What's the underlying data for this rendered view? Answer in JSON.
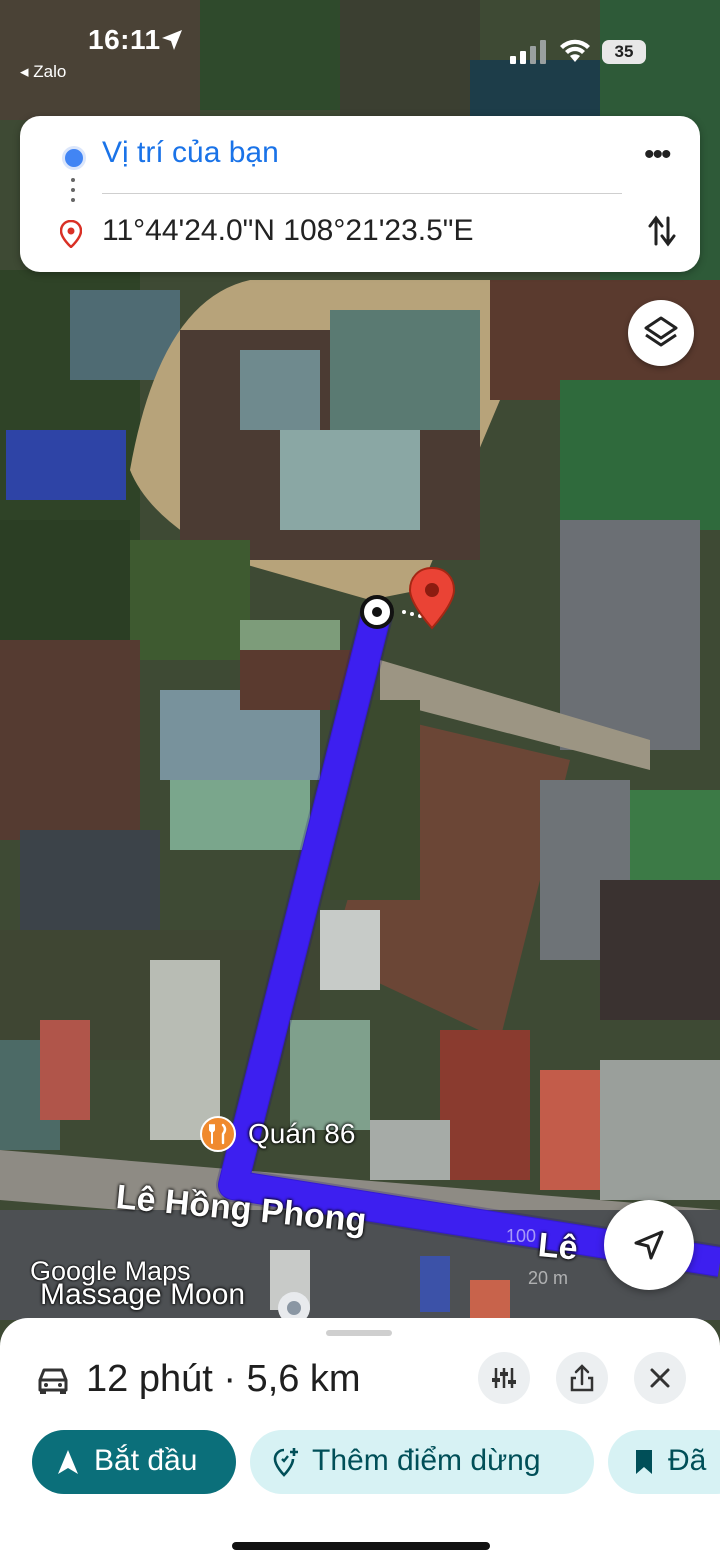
{
  "status_bar": {
    "time": "16:11",
    "back_app": "◂ Zalo",
    "battery": "35"
  },
  "route": {
    "origin": "Vị trí của bạn",
    "destination": "11°44'24.0\"N 108°21'23.5\"E"
  },
  "map": {
    "streets": [
      "Lê Hồng Phong",
      "Lê"
    ],
    "poi": "Quán 86",
    "place": "Massage Moon",
    "watermark": "Google Maps",
    "scale_labels": [
      "100",
      "20 m"
    ]
  },
  "trip": {
    "summary": "12 phút · 5,6 km"
  },
  "actions": {
    "start": "Bắt đầu",
    "add_stop": "Thêm điểm dừng",
    "save": "Đã"
  },
  "colors": {
    "route_line": "#3d1ff0",
    "origin_blue": "#1a73e8",
    "start_button": "#0b6f7a",
    "chip_bg": "#d7f2f4",
    "pin_red": "#ea4335"
  }
}
